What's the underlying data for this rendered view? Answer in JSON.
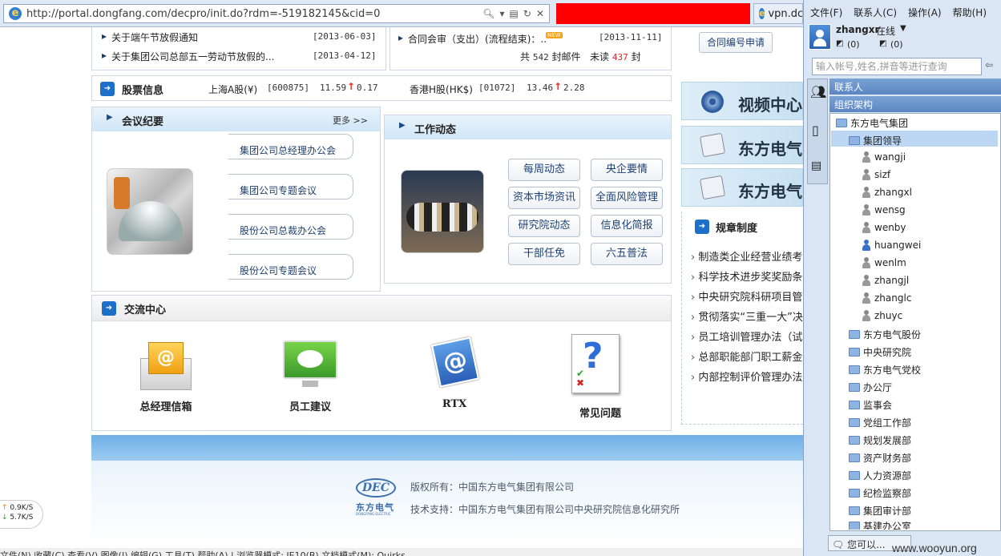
{
  "browser": {
    "url": "http://portal.dongfang.com/decpro/init.do?rdm=-519182145&cid=0",
    "second_tab": "vpn.dc"
  },
  "notices": [
    {
      "title": "关于端午节放假通知",
      "date": "[2013-06-03]"
    },
    {
      "title": "关于集团公司总部五一劳动节放假的...",
      "date": "[2013-04-12]"
    }
  ],
  "mail": {
    "item": "合同会审（支出）(流程结束)：..",
    "new_badge": "NEW",
    "date": "[2013-11-11]",
    "summary_total_prefix": "共",
    "total": "542",
    "total_suffix": "封邮件",
    "unread_prefix": "未读",
    "unread": "437",
    "unread_suffix": "封"
  },
  "contract_button": "合同编号申请",
  "stock": {
    "title": "股票信息",
    "a_label": "上海A股(¥)",
    "a_code": "[600875]",
    "a_price": "11.59",
    "a_change": "0.17",
    "h_label": "香港H股(HK$)",
    "h_code": "[01072]",
    "h_price": "13.46",
    "h_change": "2.28"
  },
  "meeting": {
    "title": "会议纪要",
    "more": "更多 >>",
    "tabs": [
      "集团公司总经理办公会",
      "集团公司专题会议",
      "股份公司总裁办公会",
      "股份公司专题会议"
    ]
  },
  "work": {
    "title": "工作动态",
    "buttons": [
      "每周动态",
      "央企要情",
      "资本市场资讯",
      "全面风险管理",
      "研究院动态",
      "信息化简报",
      "干部任免",
      "六五普法"
    ]
  },
  "right_banners": [
    "视频中心",
    "东方电气",
    "东方电气"
  ],
  "rules": {
    "title": "规章制度",
    "items": [
      "制造类企业经营业绩考核",
      "科学技术进步奖奖励条例",
      "中央研究院科研项目管理",
      "贯彻落实“三重一大”决",
      "员工培训管理办法（试行",
      "总部职能部门职工薪金管",
      "内部控制评价管理办法"
    ]
  },
  "exchange": {
    "title": "交流中心",
    "items": [
      "总经理信箱",
      "员工建议",
      "RTX",
      "常见问题"
    ]
  },
  "footer": {
    "logo_main": "DEC",
    "logo_cn": "东方电气",
    "logo_en": "DONGFANG ELECTRIC",
    "copyright": "版权所有：中国东方电气集团有限公司",
    "support": "技术支持：中国东方电气集团有限公司中央研究院信息化研究所"
  },
  "speed": {
    "up": "0.9K/S",
    "down": "5.7K/S"
  },
  "statusbar": "文件(N)  收藏(C)  查看(V)  图像(I)  编辑(G)  工具(T)  帮助(A)  |  浏览器模式: IE10(B)  文档模式(M): Quirks",
  "rtx": {
    "menu": [
      "文件(F)",
      "联系人(C)",
      "操作(A)",
      "帮助(H)"
    ],
    "user": "zhangxr",
    "status": "在线",
    "count1": "(0)",
    "count2": "(0)",
    "search_placeholder": "输入帐号,姓名,拼音等进行查询",
    "contacts_header": "联系人",
    "org_header": "组织架构",
    "root": "东方电气集团",
    "selected_group": "集团领导",
    "people": [
      "wangji",
      "sizf",
      "zhangxl",
      "wensg",
      "wenby",
      "huangwei",
      "wenlm",
      "zhangjl",
      "zhanglc",
      "zhuyc"
    ],
    "groups": [
      "东方电气股份",
      "中央研究院",
      "东方电气党校",
      "办公厅",
      "监事会",
      "党组工作部",
      "规划发展部",
      "资产财务部",
      "人力资源部",
      "纪检监察部",
      "集团审计部",
      "基建办公室"
    ],
    "bottom_hint": "您可以...",
    "watermark": "www.wooyun.org"
  }
}
